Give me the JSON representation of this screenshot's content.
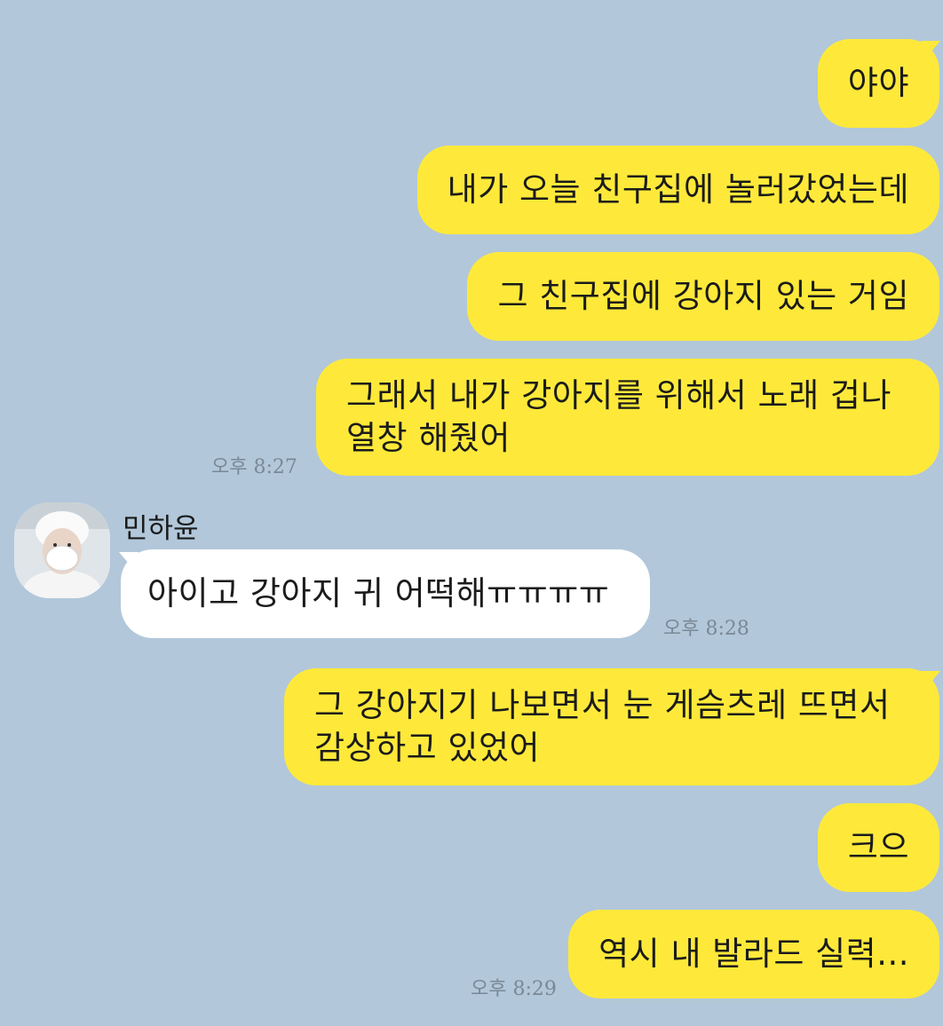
{
  "conversation": {
    "messages": [
      {
        "from": "me",
        "text": "야야"
      },
      {
        "from": "me",
        "text": "내가 오늘 친구집에 놀러갔었는데"
      },
      {
        "from": "me",
        "text": "그 친구집에 강아지 있는 거임"
      },
      {
        "from": "me",
        "text": "그래서 내가 강아지를 위해서 노래 겁나\n열창 해줬어"
      },
      {
        "from": "other",
        "sender": "민하윤",
        "text": "아이고 강아지 귀 어떡해ㅠㅠㅠㅠ"
      },
      {
        "from": "me",
        "text": "그 강아지기 나보면서 눈 게슴츠레 뜨면서\n감상하고 있었어"
      },
      {
        "from": "me",
        "text": "크으"
      },
      {
        "from": "me",
        "text": "역시 내 발라드 실력..."
      }
    ],
    "timestamps": [
      "오후 8:27",
      "오후 8:28",
      "오후 8:29"
    ],
    "friend": {
      "name": "민하윤",
      "avatar_icon": "profile-photo-icon"
    }
  },
  "colors": {
    "background": "#b2c7da",
    "my_bubble": "#fee93a",
    "their_bubble": "#ffffff",
    "timestamp": "#7a8896"
  }
}
